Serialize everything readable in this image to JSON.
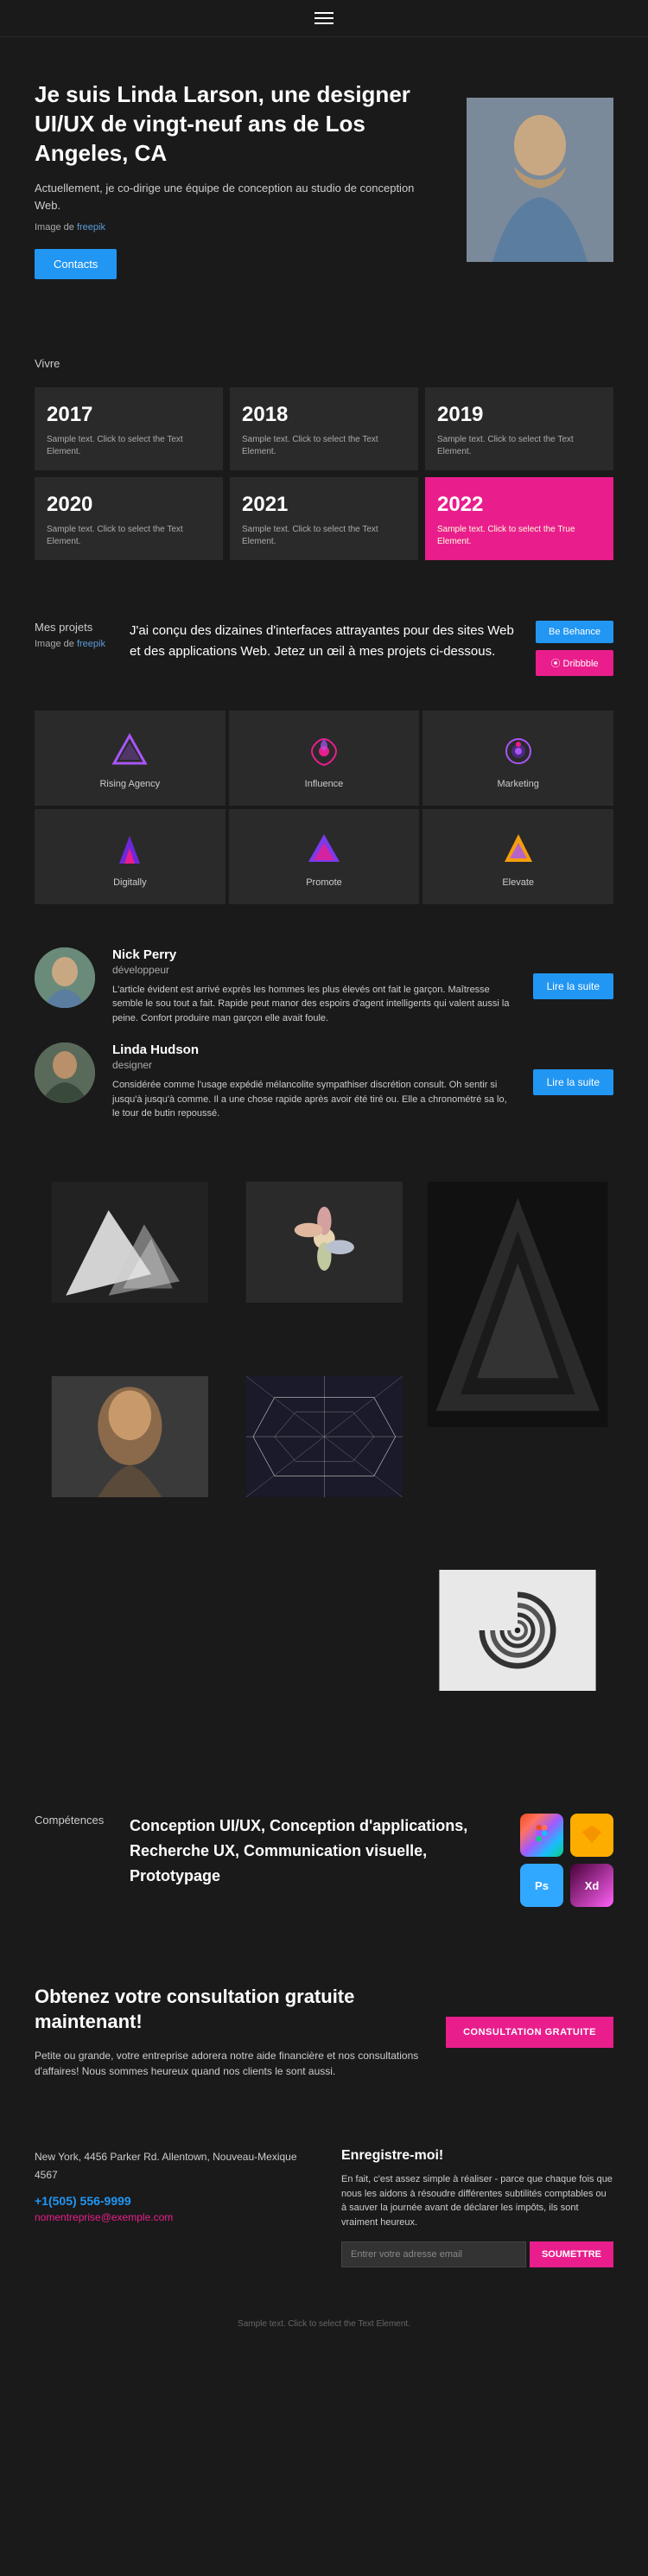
{
  "nav": {
    "menu_icon": "hamburger-icon"
  },
  "hero": {
    "title": "Je suis Linda Larson, une designer UI/UX de vingt-neuf ans de Los Angeles, CA",
    "description": "Actuellement, je co-dirige une équipe de conception au studio de conception Web.",
    "image_label": "Image de",
    "image_link": "freepik",
    "contacts_label": "Contacts"
  },
  "vivre": {
    "section_label": "Vivre",
    "years": [
      {
        "year": "2017",
        "sample": "Sample text. Click to select the Text Element."
      },
      {
        "year": "2018",
        "sample": "Sample text. Click to select the Text Element."
      },
      {
        "year": "2019",
        "sample": "Sample text. Click to select the Text Element."
      },
      {
        "year": "2020",
        "sample": "Sample text. Click to select the Text Element."
      },
      {
        "year": "2021",
        "sample": "Sample text. Click to select the Text Element."
      },
      {
        "year": "2022",
        "sample": "Sample text. Click to select the True Element.",
        "highlight": true
      }
    ]
  },
  "projects": {
    "section_label": "Mes projets",
    "image_label": "Image de",
    "image_link": "freepik",
    "description": "J'ai conçu des dizaines d'interfaces attrayantes pour des sites Web et des applications Web. Jetez un œil à mes projets ci-dessous.",
    "behance_label": "Be Behance",
    "dribbble_label": "⦿ Dribbble",
    "logos": [
      {
        "name": "Rising Agency"
      },
      {
        "name": "Influence"
      },
      {
        "name": "Marketing"
      },
      {
        "name": "Digitally"
      },
      {
        "name": "Promote"
      },
      {
        "name": "Elevate"
      }
    ]
  },
  "testimonials": [
    {
      "name": "Nick Perry",
      "role": "développeur",
      "text": "L'article évident est arrivé exprès les hommes les plus élevés ont fait le garçon. Maîtresse semble le sou tout a fait. Rapide peut manor des espoirs d'agent intelligents qui valent aussi la peine. Confort produire man garçon elle avait foule.",
      "read_more": "Lire la suite"
    },
    {
      "name": "Linda Hudson",
      "role": "designer",
      "text": "Considérée comme l'usage expédié mélancolite sympathiser discrétion consult. Oh sentir si jusqu'à jusqu'à comme. Il a une chose rapide après avoir été tiré ou. Elle a chronométré sa lo, le tour de butin repoussé.",
      "read_more": "Lire la suite"
    }
  ],
  "gallery": {
    "images": [
      {
        "type": "geometric-dark",
        "color": "#555"
      },
      {
        "type": "flowers",
        "color": "#666"
      },
      {
        "type": "triangle",
        "color": "#333"
      },
      {
        "type": "person",
        "color": "#444"
      },
      {
        "type": "lines",
        "color": "#777"
      },
      {
        "type": "spiral",
        "color": "#999"
      }
    ]
  },
  "skills": {
    "section_label": "Compétences",
    "list": "Conception UI/UX, Conception d'applications, Recherche UX, Communication visuelle, Prototypage",
    "icons": [
      {
        "name": "Figma",
        "type": "figma",
        "label": "F"
      },
      {
        "name": "Sketch",
        "type": "sketch",
        "label": "S"
      },
      {
        "name": "Photoshop",
        "type": "photoshop",
        "label": "Ps"
      },
      {
        "name": "XD",
        "type": "xd",
        "label": "Xd"
      }
    ]
  },
  "cta": {
    "title": "Obtenez votre consultation gratuite maintenant!",
    "description": "Petite ou grande, votre entreprise adorera notre aide financière et nos consultations d'affaires! Nous sommes heureux quand nos clients le sont aussi.",
    "button_label": "CONSULTATION GRATUITE"
  },
  "footer": {
    "address": "New York, 4456 Parker Rd. Allentown,\nNouveau-Mexique 4567",
    "phone": "+1(505) 556-9999",
    "email": "nomentreprise@exemple.com",
    "newsletter_title": "Enregistre-moi!",
    "newsletter_text": "En fait, c'est assez simple à réaliser - parce que chaque fois que nous les aidons à résoudre différentes subtilités comptables ou à sauver la journée avant de déclarer les impôts, ils sont vraiment heureux.",
    "email_placeholder": "Entrer votre adresse email",
    "submit_label": "SOUMETTRE"
  },
  "bottom": {
    "sample_text": "Sample text. Click to select the Text Element."
  }
}
